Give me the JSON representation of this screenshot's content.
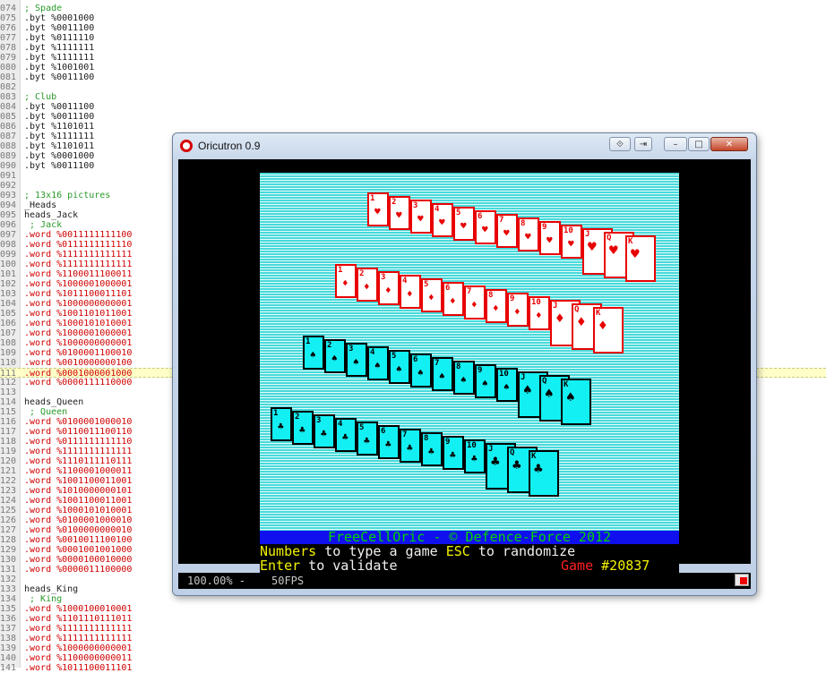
{
  "editor": {
    "lines": [
      {
        "n": "074",
        "cls": "cmt",
        "t": "; Spade"
      },
      {
        "n": "075",
        "cls": "kw",
        "t": ".byt %0001000"
      },
      {
        "n": "076",
        "cls": "kw",
        "t": ".byt %0011100"
      },
      {
        "n": "077",
        "cls": "kw",
        "t": ".byt %0111110"
      },
      {
        "n": "078",
        "cls": "kw",
        "t": ".byt %1111111"
      },
      {
        "n": "079",
        "cls": "kw",
        "t": ".byt %1111111"
      },
      {
        "n": "080",
        "cls": "kw",
        "t": ".byt %1001001"
      },
      {
        "n": "081",
        "cls": "kw",
        "t": ".byt %0011100"
      },
      {
        "n": "082",
        "cls": "kw",
        "t": ""
      },
      {
        "n": "083",
        "cls": "cmt",
        "t": "; Club"
      },
      {
        "n": "084",
        "cls": "kw",
        "t": ".byt %0011100"
      },
      {
        "n": "085",
        "cls": "kw",
        "t": ".byt %0011100"
      },
      {
        "n": "086",
        "cls": "kw",
        "t": ".byt %1101011"
      },
      {
        "n": "087",
        "cls": "kw",
        "t": ".byt %1111111"
      },
      {
        "n": "088",
        "cls": "kw",
        "t": ".byt %1101011"
      },
      {
        "n": "089",
        "cls": "kw",
        "t": ".byt %0001000"
      },
      {
        "n": "090",
        "cls": "kw",
        "t": ".byt %0011100"
      },
      {
        "n": "091",
        "cls": "kw",
        "t": ""
      },
      {
        "n": "092",
        "cls": "kw",
        "t": ""
      },
      {
        "n": "093",
        "cls": "cmt",
        "t": "; 13x16 pictures"
      },
      {
        "n": "094",
        "cls": "lbl",
        "t": "_Heads"
      },
      {
        "n": "095",
        "cls": "lbl",
        "t": "heads_Jack"
      },
      {
        "n": "096",
        "cls": "cmt",
        "t": " ; Jack"
      },
      {
        "n": "097",
        "cls": "dir",
        "t": ".word %0011111111100"
      },
      {
        "n": "098",
        "cls": "dir",
        "t": ".word %0111111111110"
      },
      {
        "n": "099",
        "cls": "dir",
        "t": ".word %1111111111111"
      },
      {
        "n": "100",
        "cls": "dir",
        "t": ".word %1111111111111"
      },
      {
        "n": "101",
        "cls": "dir",
        "t": ".word %1100011100011"
      },
      {
        "n": "102",
        "cls": "dir",
        "t": ".word %1000001000001"
      },
      {
        "n": "103",
        "cls": "dir",
        "t": ".word %1011100011101"
      },
      {
        "n": "104",
        "cls": "dir",
        "t": ".word %1000000000001"
      },
      {
        "n": "105",
        "cls": "dir",
        "t": ".word %1001101011001"
      },
      {
        "n": "106",
        "cls": "dir",
        "t": ".word %1000101010001"
      },
      {
        "n": "107",
        "cls": "dir",
        "t": ".word %1000001000001"
      },
      {
        "n": "108",
        "cls": "dir",
        "t": ".word %1000000000001"
      },
      {
        "n": "109",
        "cls": "dir",
        "t": ".word %0100001100010"
      },
      {
        "n": "110",
        "cls": "dir",
        "t": ".word %0010000000100"
      },
      {
        "n": "111",
        "cls": "dir",
        "t": ".word %0001000001000",
        "hl": true
      },
      {
        "n": "112",
        "cls": "dir",
        "t": ".word %0000111110000"
      },
      {
        "n": "113",
        "cls": "kw",
        "t": ""
      },
      {
        "n": "114",
        "cls": "lbl",
        "t": "heads_Queen"
      },
      {
        "n": "115",
        "cls": "cmt",
        "t": " ; Queen"
      },
      {
        "n": "116",
        "cls": "dir",
        "t": ".word %0100001000010"
      },
      {
        "n": "117",
        "cls": "dir",
        "t": ".word %0110011100110"
      },
      {
        "n": "118",
        "cls": "dir",
        "t": ".word %0111111111110"
      },
      {
        "n": "119",
        "cls": "dir",
        "t": ".word %1111111111111"
      },
      {
        "n": "120",
        "cls": "dir",
        "t": ".word %1110111110111"
      },
      {
        "n": "121",
        "cls": "dir",
        "t": ".word %1100001000011"
      },
      {
        "n": "122",
        "cls": "dir",
        "t": ".word %1001100011001"
      },
      {
        "n": "123",
        "cls": "dir",
        "t": ".word %1010000000101"
      },
      {
        "n": "124",
        "cls": "dir",
        "t": ".word %1001100011001"
      },
      {
        "n": "125",
        "cls": "dir",
        "t": ".word %1000101010001"
      },
      {
        "n": "126",
        "cls": "dir",
        "t": ".word %0100001000010"
      },
      {
        "n": "127",
        "cls": "dir",
        "t": ".word %0100000000010"
      },
      {
        "n": "128",
        "cls": "dir",
        "t": ".word %0010011100100"
      },
      {
        "n": "129",
        "cls": "dir",
        "t": ".word %0001001001000"
      },
      {
        "n": "130",
        "cls": "dir",
        "t": ".word %0000100010000"
      },
      {
        "n": "131",
        "cls": "dir",
        "t": ".word %0000011100000"
      },
      {
        "n": "132",
        "cls": "kw",
        "t": ""
      },
      {
        "n": "133",
        "cls": "lbl",
        "t": "heads_King"
      },
      {
        "n": "134",
        "cls": "cmt",
        "t": " ; King"
      },
      {
        "n": "135",
        "cls": "dir",
        "t": ".word %1000100010001"
      },
      {
        "n": "136",
        "cls": "dir",
        "t": ".word %1101110111011"
      },
      {
        "n": "137",
        "cls": "dir",
        "t": ".word %1111111111111"
      },
      {
        "n": "138",
        "cls": "dir",
        "t": ".word %1111111111111"
      },
      {
        "n": "139",
        "cls": "dir",
        "t": ".word %1000000000001"
      },
      {
        "n": "140",
        "cls": "dir",
        "t": ".word %1100000000011"
      },
      {
        "n": "141",
        "cls": "dir",
        "t": ".word %1011100011101"
      }
    ]
  },
  "window": {
    "title": "Oricutron 0.9",
    "controls": {
      "minimize": "–",
      "maximize": "□",
      "close": "✕",
      "move": "⟐",
      "pin": "⇥"
    }
  },
  "game": {
    "rows": [
      {
        "color": "red",
        "suit": "♥",
        "cards": [
          "1",
          "2",
          "3",
          "4",
          "5",
          "6",
          "7",
          "8",
          "9",
          "10",
          "J",
          "Q",
          "K"
        ]
      },
      {
        "color": "red",
        "suit": "♦",
        "cards": [
          "1",
          "2",
          "3",
          "4",
          "5",
          "6",
          "7",
          "8",
          "9",
          "10",
          "J",
          "Q",
          "K"
        ]
      },
      {
        "color": "cyan",
        "suit": "♠",
        "cards": [
          "1",
          "2",
          "3",
          "4",
          "5",
          "6",
          "7",
          "8",
          "9",
          "10",
          "J",
          "Q",
          "K"
        ]
      },
      {
        "color": "cyan",
        "suit": "♣",
        "cards": [
          "1",
          "2",
          "3",
          "4",
          "5",
          "6",
          "7",
          "8",
          "9",
          "10",
          "J",
          "Q",
          "K"
        ]
      }
    ],
    "banner": "FreeCellOric - © Defence-Force 2012",
    "line1": {
      "a": "Numbers",
      "b": " to type a game ",
      "c": "ESC",
      "d": " to randomize"
    },
    "line2": {
      "a": "Enter",
      "b": " to validate",
      "c": "Game ",
      "d": "#20837"
    }
  },
  "status": {
    "zoom": "100.00% -",
    "fps": "50FPS"
  },
  "colors": {
    "oric_red": "#e80000",
    "oric_cyan": "#12f0f3",
    "oric_blue": "#1010ee",
    "oric_yellow": "#f2f200",
    "oric_green": "#00d800"
  }
}
